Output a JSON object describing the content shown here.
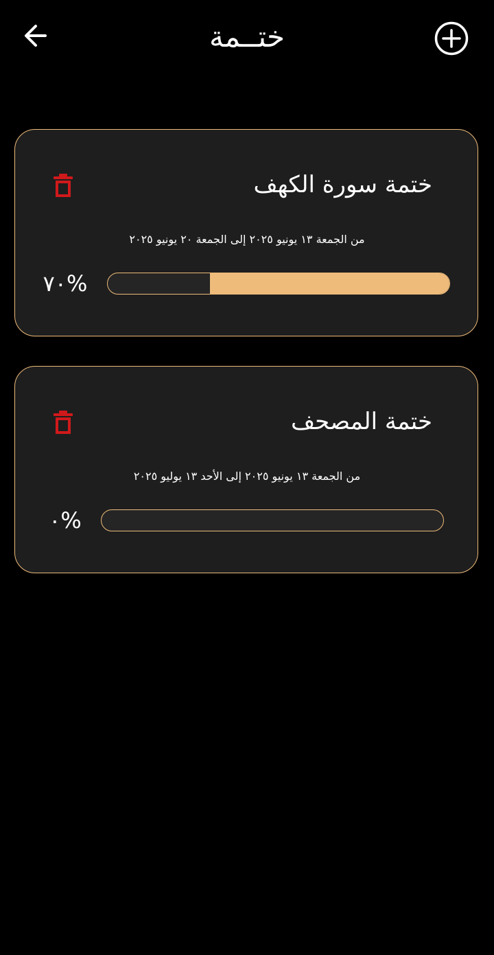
{
  "header": {
    "title": "ختــمة",
    "back_icon": "arrow-left-icon",
    "add_icon": "plus-circle-icon"
  },
  "colors": {
    "background": "#000000",
    "card_background": "#1e1e1e",
    "accent": "#eebb7a",
    "delete": "#d0191b",
    "text": "#ffffff"
  },
  "khatmas": [
    {
      "title": "ختمة سورة الكهف",
      "date_range": "من الجمعة ١٣ يونيو ٢٠٢٥ إلى الجمعة ٢٠ يونيو ٢٠٢٥",
      "progress_label": "٧٠%",
      "progress_fraction": 0.7,
      "delete_icon": "trash-icon"
    },
    {
      "title": "ختمة المصحف",
      "date_range": "من الجمعة ١٣ يونيو ٢٠٢٥ إلى الأحد ١٣ يوليو ٢٠٢٥",
      "progress_label": "٠%",
      "progress_fraction": 0,
      "delete_icon": "trash-icon"
    }
  ]
}
